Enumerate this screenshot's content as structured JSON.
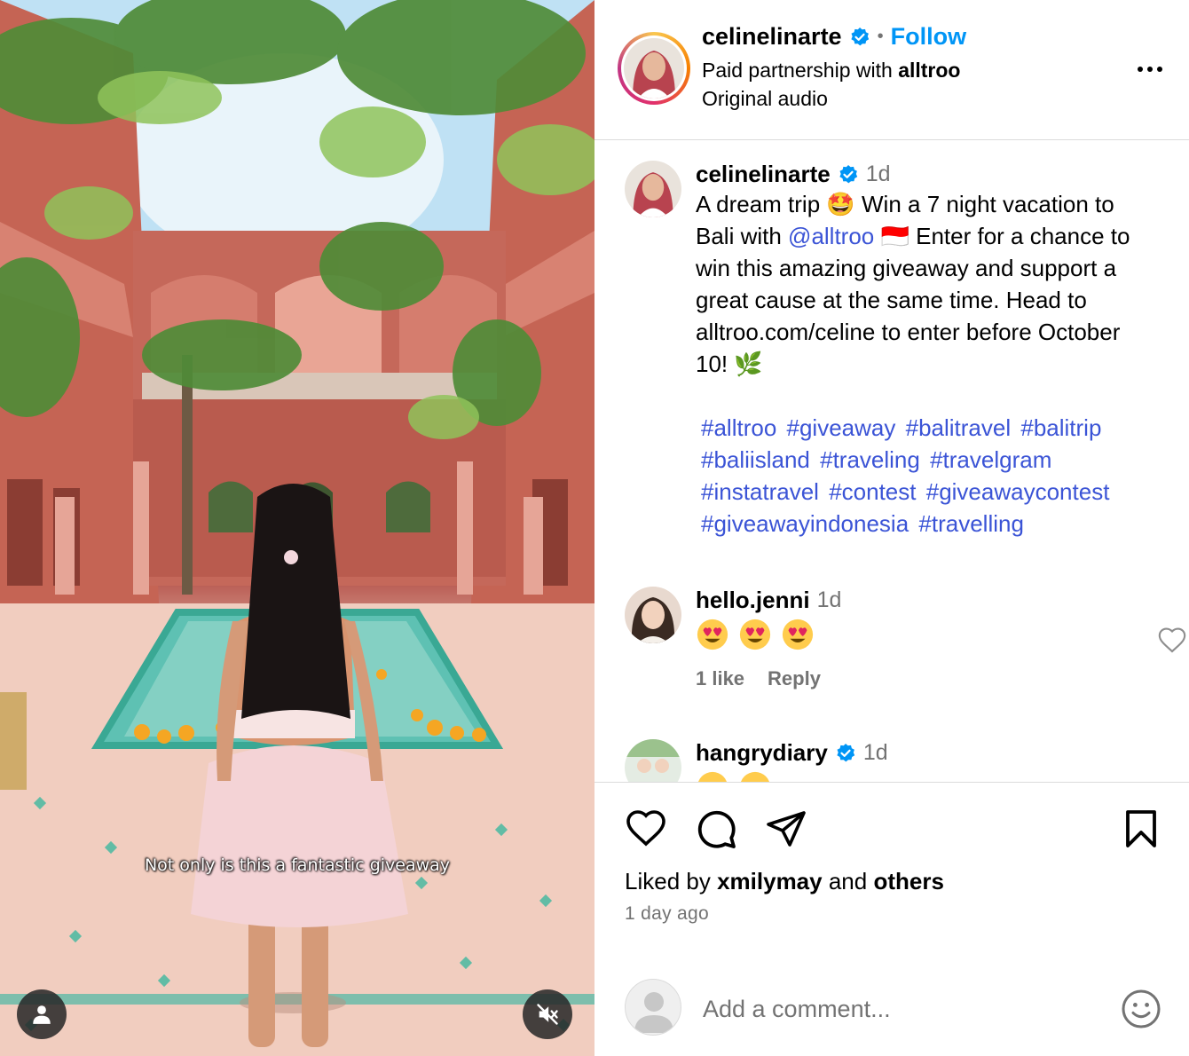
{
  "post": {
    "username": "celinelinarte",
    "follow_label": "Follow",
    "separator": "•",
    "partnership_prefix": "Paid partnership with ",
    "partner": "alltroo",
    "audio": "Original audio",
    "more_label": "More options"
  },
  "media": {
    "caption_overlay": "Not only is this a fantastic giveaway"
  },
  "caption": {
    "username": "celinelinarte",
    "time": "1d",
    "text_1": "A dream trip ",
    "emoji_1": "🤩",
    "text_2": " Win a 7 night vacation to Bali with ",
    "mention": "@alltroo",
    "emoji_2": "🇮🇩",
    "text_3": " Enter for a chance to win this amazing giveaway and support a great cause at the same time. Head to alltroo.com/celine to enter before October 10! ",
    "emoji_3": "🌿",
    "hashtags": [
      "#alltroo",
      "#giveaway",
      "#balitravel",
      "#balitrip",
      "#baliisland",
      "#traveling",
      "#travelgram",
      "#instatravel",
      "#contest",
      "#giveawaycontest",
      "#giveawayindonesia",
      "#travelling"
    ]
  },
  "comments": [
    {
      "username": "hello.jenni",
      "time": "1d",
      "verified": false,
      "likes": "1 like",
      "reply": "Reply"
    },
    {
      "username": "hangrydiary",
      "time": "1d",
      "verified": true
    }
  ],
  "actions": {
    "liked_by_prefix": "Liked by ",
    "liked_by_user": "xmilymay",
    "liked_by_and": " and ",
    "liked_by_others": "others",
    "time_ago": "1 day ago"
  },
  "add_comment": {
    "placeholder": "Add a comment..."
  },
  "colors": {
    "link": "#3b54d6",
    "follow": "#0095f6",
    "verified": "#0095f6",
    "muted": "#737373",
    "divider": "#dbdbdb"
  },
  "icons": [
    "verified-badge-icon",
    "more-icon",
    "heart-icon",
    "comment-icon",
    "share-icon",
    "bookmark-icon",
    "emoji-icon",
    "user-tag-icon",
    "muted-speaker-icon"
  ]
}
